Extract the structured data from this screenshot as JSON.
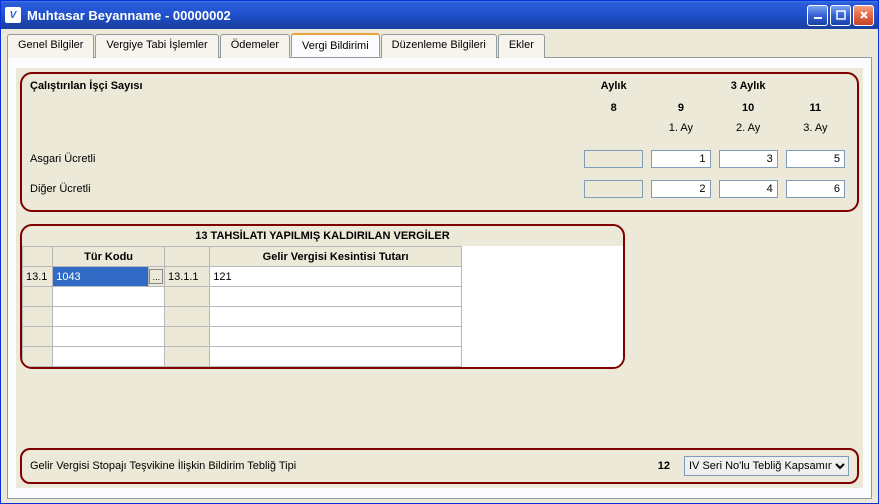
{
  "window": {
    "title": "Muhtasar Beyanname - 00000002"
  },
  "tabs": {
    "items": [
      {
        "label": "Genel Bilgiler"
      },
      {
        "label": "Vergiye Tabi İşlemler"
      },
      {
        "label": "Ödemeler"
      },
      {
        "label": "Vergi Bildirimi"
      },
      {
        "label": "Düzenleme Bilgileri"
      },
      {
        "label": "Ekler"
      }
    ],
    "active": 3
  },
  "worker_section": {
    "title": "Çalıştırılan İşçi Sayısı",
    "period_month": "Aylık",
    "period_quarter": "3 Aylık",
    "col_nums": [
      "8",
      "9",
      "10",
      "11"
    ],
    "ay_labels": [
      "",
      "1. Ay",
      "2. Ay",
      "3. Ay"
    ],
    "rows": [
      {
        "label": "Asgari Ücretli",
        "values": [
          "",
          "1",
          "3",
          "5"
        ],
        "disabled": [
          true,
          false,
          false,
          false
        ]
      },
      {
        "label": "Diğer Ücretli",
        "values": [
          "",
          "2",
          "4",
          "6"
        ],
        "disabled": [
          true,
          false,
          false,
          false
        ]
      }
    ]
  },
  "grid_section": {
    "title": "13 TAHSİLATI YAPILMIŞ KALDIRILAN VERGİLER",
    "headers": {
      "tur_kodu": "Tür Kodu",
      "tutar": "Gelir Vergisi Kesintisi Tutarı"
    },
    "rows": [
      {
        "rowhdr": "13.1",
        "turkodu": "1043",
        "code": "13.1.1",
        "tutar": "121"
      },
      {
        "rowhdr": "",
        "turkodu": "",
        "code": "",
        "tutar": ""
      },
      {
        "rowhdr": "",
        "turkodu": "",
        "code": "",
        "tutar": ""
      },
      {
        "rowhdr": "",
        "turkodu": "",
        "code": "",
        "tutar": ""
      },
      {
        "rowhdr": "",
        "turkodu": "",
        "code": "",
        "tutar": ""
      }
    ],
    "lookup_btn": "..."
  },
  "bottom_section": {
    "label": "Gelir Vergisi Stopajı Teşvikine İlişkin Bildirim Tebliğ Tipi",
    "index": "12",
    "selected": "IV Seri No'lu Tebliğ Kapsamında"
  }
}
